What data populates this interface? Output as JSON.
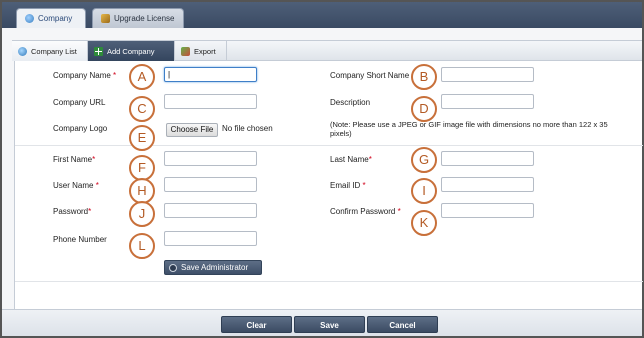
{
  "top_tabs": [
    {
      "label": "Company",
      "icon": "company-icon"
    },
    {
      "label": "Upgrade License",
      "icon": "license-icon"
    }
  ],
  "sub_tabs": [
    {
      "label": "Company List",
      "icon": "company-list-icon"
    },
    {
      "label": "Add Company",
      "icon": "add-icon"
    },
    {
      "label": "Export",
      "icon": "export-icon"
    }
  ],
  "form": {
    "company_name": "Company Name",
    "company_short_name": "Company Short Name",
    "company_url": "Company URL",
    "description": "Description",
    "company_logo": "Company Logo",
    "choose_file": "Choose File",
    "no_file": "No file chosen",
    "logo_note": "(Note: Please use a JPEG or GIF image file with dimensions no more than 122 x 35 pixels)",
    "first_name": "First Name",
    "last_name": "Last Name",
    "user_name": "User Name",
    "email_id": "Email ID",
    "password": "Password",
    "confirm_password": "Confirm Password",
    "phone_number": "Phone Number",
    "required_mark": "*",
    "save_admin": "Save Administrator"
  },
  "annotations": [
    "A",
    "B",
    "C",
    "D",
    "E",
    "F",
    "G",
    "H",
    "I",
    "J",
    "K",
    "L"
  ],
  "footer": {
    "clear": "Clear",
    "save": "Save",
    "cancel": "Cancel"
  },
  "colors": {
    "header": "#3f4f68",
    "annotation_circle": "#c8703a",
    "required": "#d0021b"
  }
}
